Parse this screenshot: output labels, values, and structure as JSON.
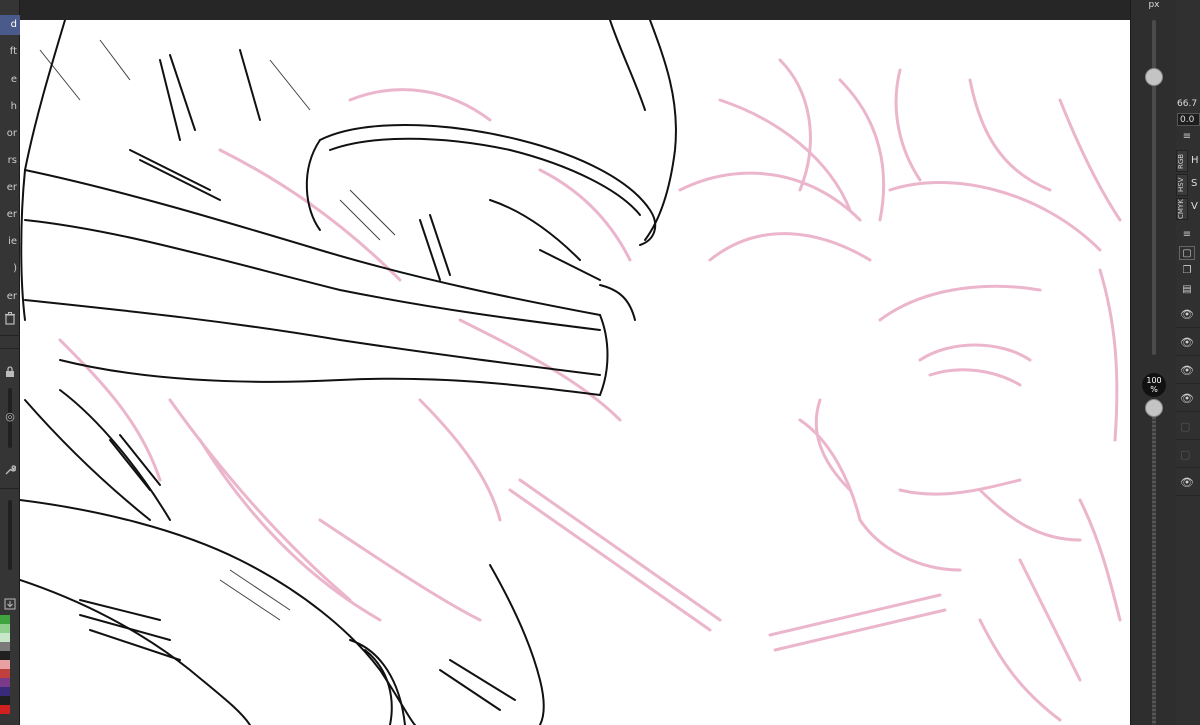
{
  "left_toolbar": {
    "tools": [
      {
        "label": "d",
        "active": true
      },
      {
        "label": "ft"
      },
      {
        "label": "e"
      },
      {
        "label": "h"
      },
      {
        "label": "or"
      },
      {
        "label": "rs"
      },
      {
        "label": "er"
      },
      {
        "label": "er"
      },
      {
        "label": "ie"
      },
      {
        "label": ")"
      },
      {
        "label": "er"
      }
    ],
    "icons": {
      "trash": "trash-icon",
      "lock": "lock-icon",
      "wrench": "wrench-icon",
      "import": "import-icon"
    },
    "palette": [
      "#3fa33f",
      "#8fd08f",
      "#c8e6c8",
      "#7a7a7a",
      "#202020",
      "#c04040",
      "#e8a0a0",
      "#7a3a8a",
      "#3a2a7a",
      "#d02020"
    ]
  },
  "slider_column": {
    "size_unit": "px",
    "size_value_fraction": 0.83,
    "opacity_value": "100",
    "opacity_unit": "%",
    "opacity_fraction": 1.0
  },
  "right_docker": {
    "zoom_value": "66.7",
    "angle_value": "0.0",
    "color_tabs": [
      "RGB",
      "HSV",
      "CMYK"
    ],
    "channel_letters": [
      "H",
      "S",
      "V"
    ],
    "layers": [
      {
        "visible": true
      },
      {
        "visible": true
      },
      {
        "visible": true
      },
      {
        "visible": true
      },
      {
        "visible": false
      },
      {
        "visible": false
      },
      {
        "visible": true
      }
    ]
  }
}
